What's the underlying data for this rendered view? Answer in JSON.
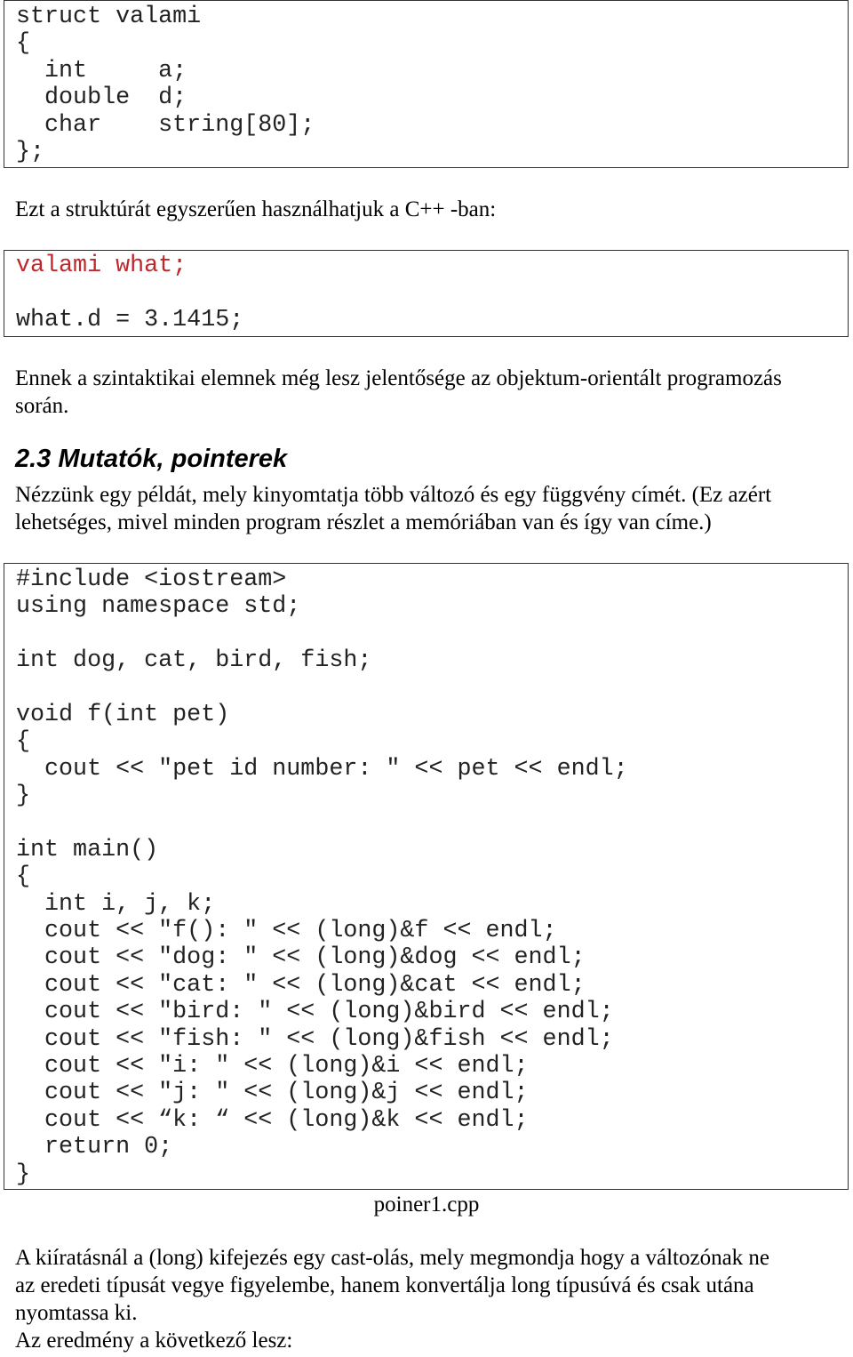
{
  "code_block_1": [
    "struct valami",
    "{",
    "  int     a;",
    "  double  d;",
    "  char    string[80];",
    "};"
  ],
  "paragraph_1": [
    "Ezt a struktúrát egyszerűen használhatjuk a C++ -ban:"
  ],
  "code_block_2": [
    "valami what;",
    "",
    "what.d = 3.1415;"
  ],
  "code_block_2_highlight_color": "#c0272d",
  "paragraph_2": [
    "Ennek a szintaktikai elemnek még lesz jelentősége az objektum-orientált programozás",
    "során."
  ],
  "heading": "2.3 Mutatók, pointerek",
  "paragraph_3": [
    "Nézzünk egy példát, mely kinyomtatja több változó és egy függvény címét. (Ez azért",
    "lehetséges, mivel minden program részlet a memóriában van és így van címe.)"
  ],
  "code_block_3": [
    "#include <iostream>",
    "using namespace std;",
    "",
    "int dog, cat, bird, fish;",
    "",
    "void f(int pet)",
    "{",
    "  cout << \"pet id number: \" << pet << endl;",
    "}",
    "",
    "int main()",
    "{",
    "  int i, j, k;",
    "  cout << \"f(): \" << (long)&f << endl;",
    "  cout << \"dog: \" << (long)&dog << endl;",
    "  cout << \"cat: \" << (long)&cat << endl;",
    "  cout << \"bird: \" << (long)&bird << endl;",
    "  cout << \"fish: \" << (long)&fish << endl;",
    "  cout << \"i: \" << (long)&i << endl;",
    "  cout << \"j: \" << (long)&j << endl;",
    "  cout << “k: “ << (long)&k << endl;",
    "  return 0;",
    "}"
  ],
  "caption": "poiner1.cpp",
  "paragraph_4": [
    "A kiíratásnál a (long) kifejezés egy cast-olás, mely megmondja hogy a változónak ne",
    "az eredeti típusát vegye figyelembe, hanem konvertálja long típusúvá és csak utána",
    "nyomtassa ki.",
    "Az eredmény a következő lesz:"
  ]
}
